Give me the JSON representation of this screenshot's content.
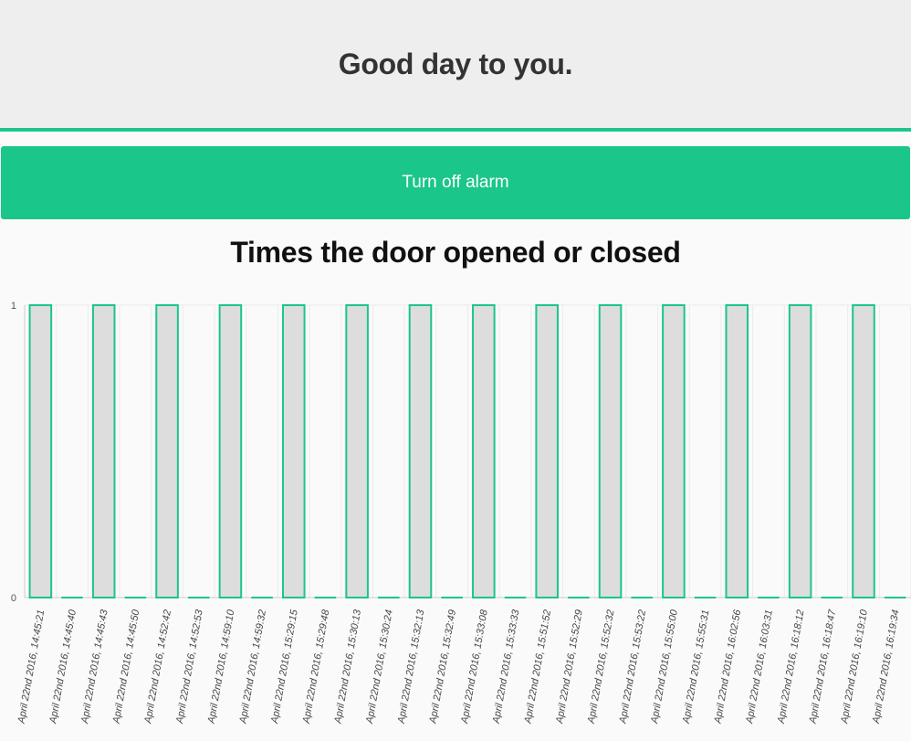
{
  "header": {
    "greeting": "Good day to you."
  },
  "alarm": {
    "button_label": "Turn off alarm"
  },
  "colors": {
    "accent": "#1ac68a",
    "bar_fill": "#dddddd",
    "header_bg": "#eeeeee"
  },
  "chart_data": {
    "type": "bar",
    "title": "Times the door opened or closed",
    "xlabel": "",
    "ylabel": "",
    "ylim": [
      0,
      1
    ],
    "yticks": [
      0,
      1
    ],
    "grid": true,
    "categories": [
      "April 22nd 2016, 14:45:21",
      "April 22nd 2016, 14:45:40",
      "April 22nd 2016, 14:45:43",
      "April 22nd 2016, 14:45:50",
      "April 22nd 2016, 14:52:42",
      "April 22nd 2016, 14:52:53",
      "April 22nd 2016, 14:59:10",
      "April 22nd 2016, 14:59:32",
      "April 22nd 2016, 15:29:15",
      "April 22nd 2016, 15:29:48",
      "April 22nd 2016, 15:30:13",
      "April 22nd 2016, 15:30:24",
      "April 22nd 2016, 15:32:13",
      "April 22nd 2016, 15:32:49",
      "April 22nd 2016, 15:33:08",
      "April 22nd 2016, 15:33:33",
      "April 22nd 2016, 15:51:52",
      "April 22nd 2016, 15:52:29",
      "April 22nd 2016, 15:52:32",
      "April 22nd 2016, 15:53:22",
      "April 22nd 2016, 15:55:00",
      "April 22nd 2016, 15:55:31",
      "April 22nd 2016, 16:02:56",
      "April 22nd 2016, 16:03:31",
      "April 22nd 2016, 16:18:12",
      "April 22nd 2016, 16:18:47",
      "April 22nd 2016, 16:19:10",
      "April 22nd 2016, 16:19:34"
    ],
    "values": [
      1,
      0,
      1,
      0,
      1,
      0,
      1,
      0,
      1,
      0,
      1,
      0,
      1,
      0,
      1,
      0,
      1,
      0,
      1,
      0,
      1,
      0,
      1,
      0,
      1,
      0,
      1,
      0
    ]
  }
}
